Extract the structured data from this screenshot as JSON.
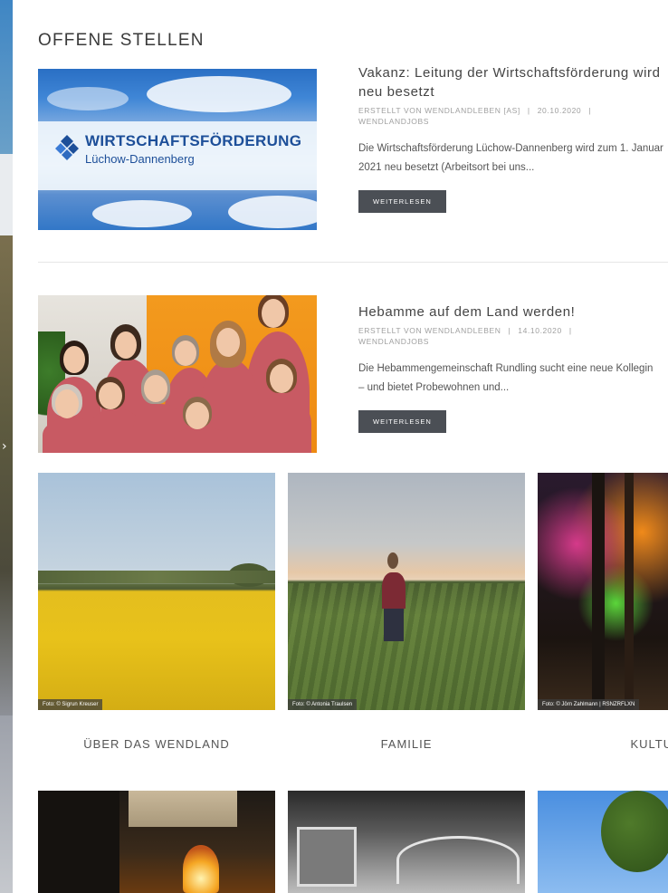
{
  "section_title": "OFFENE STELLEN",
  "posts": [
    {
      "title": "Vakanz: Leitung der Wirtschaftsförderung wird neu besetzt",
      "meta_prefix": "ERSTELLT VON",
      "author": "WENDLANDLEBEN [AS]",
      "date": "20.10.2020",
      "category": "WENDLANDJOBS",
      "excerpt": "Die Wirtschaftsförderung Lüchow-Dannenberg wird zum 1. Januar 2021 neu besetzt (Arbeitsort bei uns...",
      "read_more": "WEITERLESEN",
      "image": {
        "logo_name": "WIRTSCHAFTSFÖRDERUNG",
        "logo_sub": "Lüchow-Dannenberg"
      }
    },
    {
      "title": "Hebamme auf dem Land werden!",
      "meta_prefix": "ERSTELLT VON",
      "author": "WENDLANDLEBEN",
      "date": "14.10.2020",
      "category": "WENDLANDJOBS",
      "excerpt": "Die Hebammengemeinschaft Rundling sucht eine neue Kollegin – und bietet Probewohnen und...",
      "read_more": "WEITERLESEN"
    }
  ],
  "gallery": [
    {
      "label": "ÜBER DAS WENDLAND",
      "credit": "Foto: © Sigrun Kreuser"
    },
    {
      "label": "FAMILIE",
      "credit": "Foto: © Antonia Traulsen"
    },
    {
      "label": "KULTUR",
      "credit": "Foto: © Jörn Zahlmann | RSNZRFLXN"
    }
  ],
  "colors": {
    "button_bg": "#4b4f55",
    "logo_blue": "#1d4f99",
    "scrub_pink": "#c85a63",
    "wall_orange": "#f39a1e",
    "rapeseed_yellow": "#e8c21a"
  }
}
